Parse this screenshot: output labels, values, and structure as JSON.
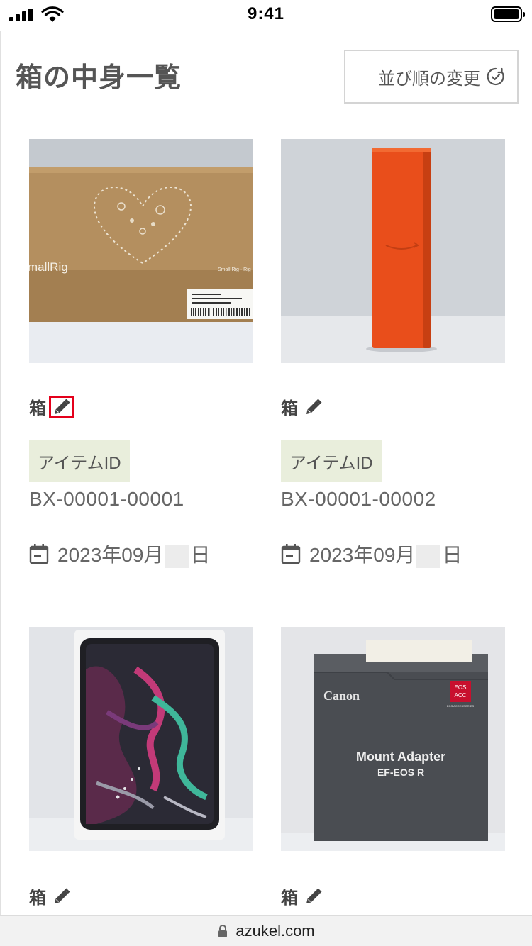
{
  "status_bar": {
    "time": "9:41"
  },
  "header": {
    "title": "箱の中身一覧",
    "sort_button_label": "並び順の変更",
    "sort_icon": "clock-icon"
  },
  "items": [
    {
      "box_label": "箱",
      "id_label": "アイテムID",
      "id_value": "BX-00001-00001",
      "date_prefix": "2023年09月",
      "date_suffix": "日",
      "image": "cardboard-box-photo",
      "edit_icon": "pencil-icon",
      "edit_highlighted": true
    },
    {
      "box_label": "箱",
      "id_label": "アイテムID",
      "id_value": "BX-00001-00002",
      "date_prefix": "2023年09月",
      "date_suffix": "日",
      "image": "orange-box-photo",
      "edit_icon": "pencil-icon",
      "edit_highlighted": false
    },
    {
      "box_label": "箱",
      "image": "tablet-box-photo",
      "edit_icon": "pencil-icon"
    },
    {
      "box_label": "箱",
      "image": "mount-adapter-box-photo",
      "edit_icon": "pencil-icon"
    }
  ],
  "photo_text": {
    "brand_1": "mallRig",
    "brand_1_small": "Small Rig · Rig",
    "brand_4": "Canon",
    "product_4_line1": "Mount Adapter",
    "product_4_line2": "EF-EOS R",
    "badge_4_line1": "EOS",
    "badge_4_line2": "ACC",
    "badge_4_caption": "EOS ACCESSORIES"
  },
  "url_bar": {
    "url": "azukel.com"
  },
  "colors": {
    "badge_bg": "#e9eedc",
    "highlight": "#e4001b",
    "text": "#555555"
  }
}
